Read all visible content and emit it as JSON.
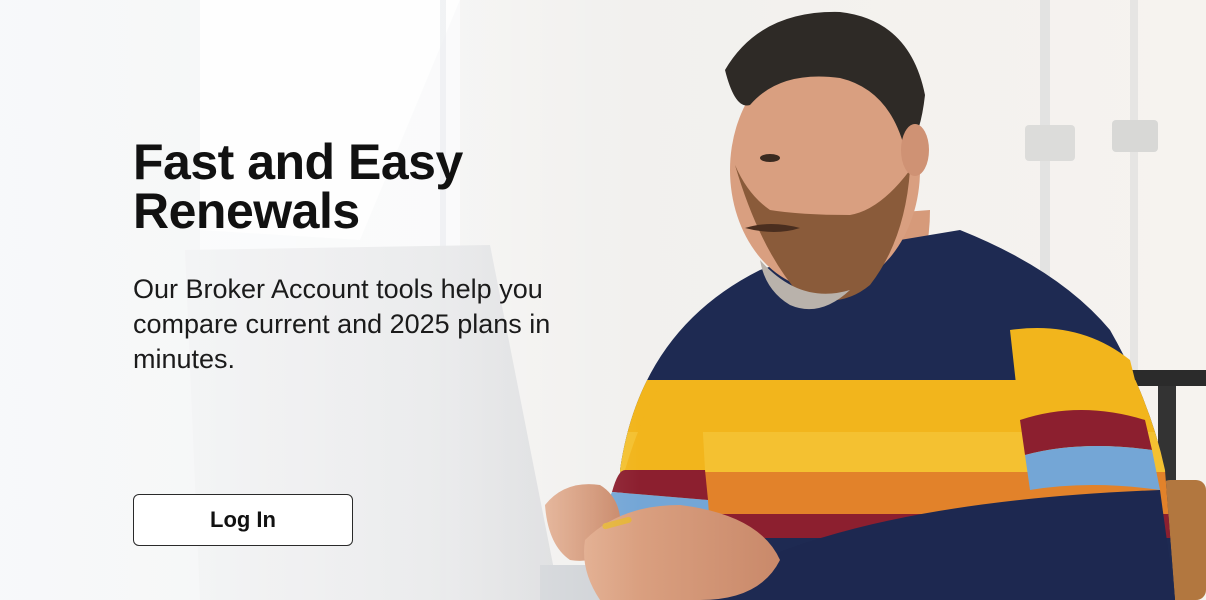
{
  "hero": {
    "headline": "Fast and Easy Renewals",
    "subtext": "Our Broker Account tools help you compare current and 2025 plans in minutes.",
    "login_label": "Log In"
  },
  "colors": {
    "headline": "#111111",
    "button_border": "#2a2a2a",
    "sweater_navy": "#1e2a52",
    "sweater_yellow": "#f2b51c",
    "sweater_orange": "#e2822a",
    "sweater_red": "#8c1f2f",
    "sweater_blue": "#74a6d6"
  }
}
